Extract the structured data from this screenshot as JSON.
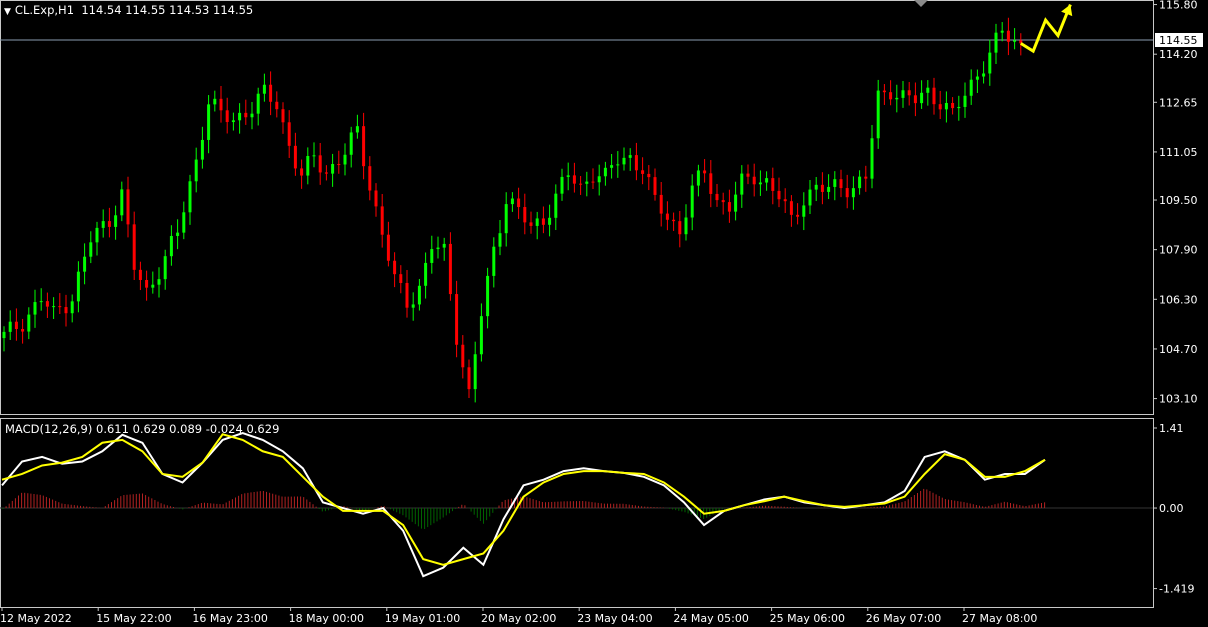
{
  "header": {
    "symbol": "CL.Exp,H1",
    "ohlc": "114.54 114.55 114.53 114.55"
  },
  "macd_header": {
    "label": "MACD(12,26,9)",
    "values": "0.611 0.629 0.089 -0.024 0.629"
  },
  "current_price_label": "114.55",
  "colors": {
    "bull": "#00ff00",
    "bear": "#ff0000",
    "macd_line": "#ffffff",
    "signal_line": "#ffff00",
    "hist_pos": "#b22222",
    "hist_neg": "#006400",
    "arrow": "#ffff00"
  },
  "chart_data": [
    {
      "type": "candlestick",
      "title": "CL.Exp,H1",
      "y_ticks": [
        "115.80",
        "114.20",
        "112.65",
        "111.05",
        "109.50",
        "107.90",
        "106.30",
        "104.70",
        "103.10"
      ],
      "ylim": [
        102.7,
        115.85
      ],
      "x_tick_labels": [
        "12 May 2022",
        "15 May 22:00",
        "16 May 23:00",
        "18 May 00:00",
        "19 May 01:00",
        "20 May 02:00",
        "23 May 04:00",
        "24 May 05:00",
        "25 May 06:00",
        "26 May 07:00",
        "27 May 08:00"
      ],
      "grid": false,
      "close_path": [
        [
          0,
          105.1
        ],
        [
          3,
          105.6
        ],
        [
          6,
          106.3
        ],
        [
          8,
          105.8
        ],
        [
          11,
          106.4
        ],
        [
          14,
          108.2
        ],
        [
          17,
          108.9
        ],
        [
          19,
          109.7
        ],
        [
          21,
          107.3
        ],
        [
          23,
          106.5
        ],
        [
          25,
          107.3
        ],
        [
          28,
          108.4
        ],
        [
          31,
          110.8
        ],
        [
          33,
          112.7
        ],
        [
          35,
          112.2
        ],
        [
          37,
          112.1
        ],
        [
          40,
          112.5
        ],
        [
          42,
          112.9
        ],
        [
          44,
          112.6
        ],
        [
          46,
          111.3
        ],
        [
          48,
          110.2
        ],
        [
          50,
          110.9
        ],
        [
          52,
          110.4
        ],
        [
          55,
          111.0
        ],
        [
          57,
          111.7
        ],
        [
          59,
          110.0
        ],
        [
          61,
          108.4
        ],
        [
          63,
          106.9
        ],
        [
          65,
          106.2
        ],
        [
          67,
          106.7
        ],
        [
          69,
          108.0
        ],
        [
          71,
          107.8
        ],
        [
          73,
          105.2
        ],
        [
          75,
          103.2
        ],
        [
          77,
          105.8
        ],
        [
          79,
          107.9
        ],
        [
          81,
          109.6
        ],
        [
          83,
          109.1
        ],
        [
          85,
          108.6
        ],
        [
          87,
          108.9
        ],
        [
          89,
          109.6
        ],
        [
          91,
          110.3
        ],
        [
          93,
          109.9
        ],
        [
          95,
          110.4
        ],
        [
          97,
          110.2
        ],
        [
          99,
          110.8
        ],
        [
          101,
          110.9
        ],
        [
          103,
          110.5
        ],
        [
          105,
          109.4
        ],
        [
          107,
          109.0
        ],
        [
          109,
          108.5
        ],
        [
          111,
          109.8
        ],
        [
          113,
          110.4
        ],
        [
          115,
          109.5
        ],
        [
          117,
          109.3
        ],
        [
          119,
          110.0
        ],
        [
          121,
          110.3
        ],
        [
          123,
          110.1
        ],
        [
          125,
          109.6
        ],
        [
          127,
          108.8
        ],
        [
          129,
          109.6
        ],
        [
          131,
          109.9
        ],
        [
          133,
          109.8
        ],
        [
          135,
          110.0
        ],
        [
          137,
          109.9
        ],
        [
          139,
          110.2
        ],
        [
          141,
          112.8
        ],
        [
          143,
          113.1
        ],
        [
          145,
          112.8
        ],
        [
          147,
          112.7
        ],
        [
          149,
          113.0
        ],
        [
          151,
          112.7
        ],
        [
          153,
          112.2
        ],
        [
          155,
          112.9
        ],
        [
          157,
          113.6
        ],
        [
          159,
          114.2
        ],
        [
          161,
          114.9
        ],
        [
          163,
          114.6
        ],
        [
          164,
          114.55
        ]
      ],
      "forecast_arrow": [
        [
          164,
          114.55
        ],
        [
          166,
          114.3
        ],
        [
          168,
          115.3
        ],
        [
          170,
          114.8
        ],
        [
          172,
          115.8
        ]
      ]
    },
    {
      "type": "macd",
      "title": "MACD(12,26,9)",
      "y_ticks": [
        "1.41",
        "0.00",
        "-1.419"
      ],
      "ylim": [
        -1.62,
        1.41
      ],
      "series": [
        {
          "role": "macd",
          "values": [
            0.4,
            0.82,
            0.9,
            0.78,
            0.82,
            1.0,
            1.29,
            1.15,
            0.6,
            0.45,
            0.8,
            1.2,
            1.32,
            1.2,
            1.0,
            0.7,
            0.1,
            0.0,
            -0.1,
            0.0,
            -0.4,
            -1.2,
            -1.05,
            -0.7,
            -1.0,
            -0.2,
            0.4,
            0.5,
            0.65,
            0.7,
            0.65,
            0.62,
            0.55,
            0.4,
            0.1,
            -0.3,
            -0.05,
            0.05,
            0.15,
            0.2,
            0.1,
            0.05,
            0.0,
            0.05,
            0.1,
            0.3,
            0.9,
            1.0,
            0.85,
            0.5,
            0.6,
            0.6,
            0.85
          ]
        },
        {
          "role": "signal",
          "values": [
            0.5,
            0.6,
            0.75,
            0.8,
            0.9,
            1.15,
            1.2,
            1.0,
            0.6,
            0.55,
            0.8,
            1.3,
            1.2,
            1.0,
            0.9,
            0.55,
            0.2,
            -0.05,
            -0.05,
            -0.05,
            -0.3,
            -0.9,
            -1.0,
            -0.9,
            -0.8,
            -0.4,
            0.2,
            0.45,
            0.6,
            0.65,
            0.65,
            0.62,
            0.6,
            0.45,
            0.2,
            -0.1,
            -0.05,
            0.05,
            0.12,
            0.2,
            0.12,
            0.05,
            0.02,
            0.05,
            0.08,
            0.2,
            0.6,
            0.95,
            0.85,
            0.55,
            0.55,
            0.65,
            0.85
          ]
        }
      ]
    }
  ]
}
